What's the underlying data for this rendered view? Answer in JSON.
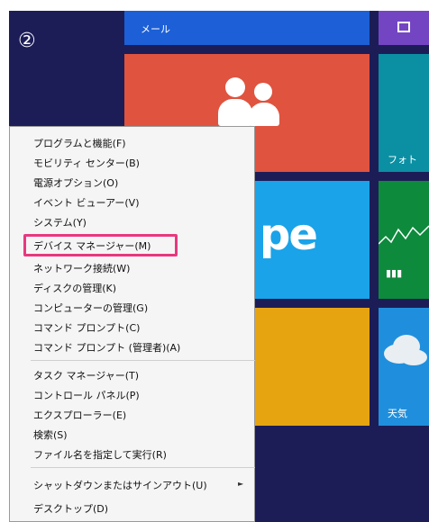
{
  "step_marker": "②",
  "tiles": {
    "mail_label": "メール",
    "photo_label": "フォト",
    "weather_label": "天気",
    "skype_text": "pe"
  },
  "context_menu": {
    "items": [
      {
        "label": "プログラムと機能(F)"
      },
      {
        "label": "モビリティ センター(B)"
      },
      {
        "label": "電源オプション(O)"
      },
      {
        "label": "イベント ビューアー(V)"
      },
      {
        "label": "システム(Y)"
      },
      {
        "label": "デバイス マネージャー(M)",
        "highlighted": true
      },
      {
        "label": "ネットワーク接続(W)"
      },
      {
        "label": "ディスクの管理(K)"
      },
      {
        "label": "コンピューターの管理(G)"
      },
      {
        "label": "コマンド プロンプト(C)"
      },
      {
        "label": "コマンド プロンプト (管理者)(A)"
      },
      {
        "label": "タスク マネージャー(T)"
      },
      {
        "label": "コントロール パネル(P)"
      },
      {
        "label": "エクスプローラー(E)"
      },
      {
        "label": "検索(S)"
      },
      {
        "label": "ファイル名を指定して実行(R)"
      },
      {
        "label": "シャットダウンまたはサインアウト(U)",
        "has_submenu": true
      },
      {
        "label": "デスクトップ(D)"
      }
    ]
  },
  "colors": {
    "highlight_border": "#e8387e",
    "start_background": "#1c1d57"
  }
}
